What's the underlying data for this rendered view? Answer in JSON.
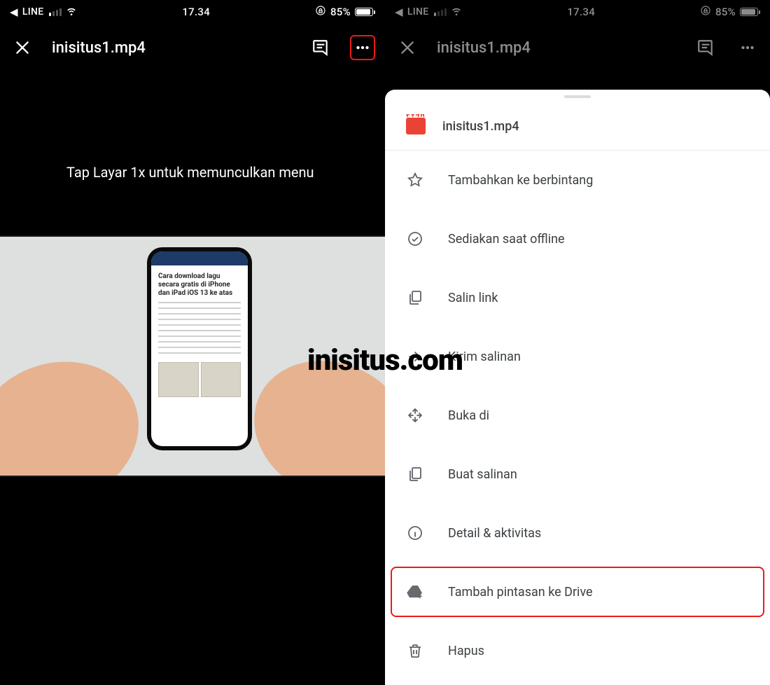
{
  "statusbar": {
    "back_app": "LINE",
    "time": "17.34",
    "battery_pct": "85%"
  },
  "header": {
    "filename": "inisitus1.mp4"
  },
  "hint_text": "Tap Layar 1x untuk memunculkan menu",
  "phone_article": {
    "title": "Cara download lagu secara gratis di iPhone dan iPad iOS 13 ke atas"
  },
  "watermark": "inisitus.com",
  "sheet": {
    "filename": "inisitus1.mp4",
    "items": [
      {
        "label": "Tambahkan ke berbintang",
        "icon": "star"
      },
      {
        "label": "Sediakan saat offline",
        "icon": "offline"
      },
      {
        "label": "Salin link",
        "icon": "copylink"
      },
      {
        "label": "Kirim salinan",
        "icon": "send"
      },
      {
        "label": "Buka di",
        "icon": "openin"
      },
      {
        "label": "Buat salinan",
        "icon": "copyfile"
      },
      {
        "label": "Detail & aktivitas",
        "icon": "info"
      },
      {
        "label": "Tambah pintasan ke Drive",
        "icon": "drive"
      },
      {
        "label": "Hapus",
        "icon": "trash"
      }
    ]
  }
}
